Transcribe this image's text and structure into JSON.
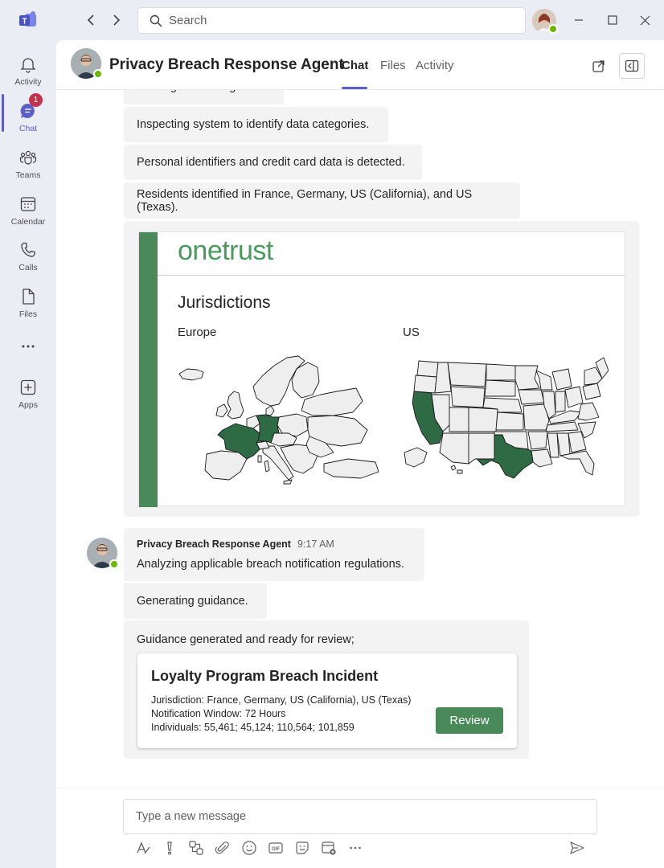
{
  "titlebar": {
    "search_placeholder": "Search"
  },
  "rail": {
    "items": [
      {
        "label": "Activity",
        "icon": "bell-icon"
      },
      {
        "label": "Chat",
        "icon": "chat-icon",
        "badge": "1"
      },
      {
        "label": "Teams",
        "icon": "teams-icon"
      },
      {
        "label": "Calendar",
        "icon": "calendar-icon"
      },
      {
        "label": "Calls",
        "icon": "phone-icon"
      },
      {
        "label": "Files",
        "icon": "file-icon"
      },
      {
        "label": "",
        "icon": "more-icon"
      },
      {
        "label": "Apps",
        "icon": "apps-icon"
      }
    ]
  },
  "header": {
    "title": "Privacy Breach Response Agent",
    "tabs": [
      "Chat",
      "Files",
      "Activity"
    ],
    "active_tab": "Chat"
  },
  "messages": {
    "m0": "Starting an investigation.",
    "m1": "Inspecting system to identify data categories.",
    "m2": "Personal identifiers and credit card data is detected.",
    "m3": "Residents identified in France, Germany, US (California), and US (Texas).",
    "sender": "Privacy Breach Response Agent",
    "time": "9:17 AM",
    "m4": "Analyzing applicable breach notification regulations.",
    "m5": "Generating guidance.",
    "m6": "Guidance generated and ready for review;"
  },
  "jurisdiction_card": {
    "brand": "onetrust",
    "heading": "Jurisdictions",
    "left_label": "Europe",
    "right_label": "US",
    "highlight_color": "#2e6b45",
    "highlighted_regions": [
      "France",
      "Germany",
      "California",
      "Texas"
    ]
  },
  "guidance_card": {
    "title": "Loyalty Program Breach Incident",
    "jurisdiction": "Jurisdiction: France, Germany, US (California), US (Texas)",
    "window": "Notification Window: 72 Hours",
    "individuals": "Individuals: 55,461; 45,124; 110,564; 101,859",
    "button": "Review"
  },
  "compose": {
    "placeholder": "Type a new message"
  },
  "colors": {
    "accent": "#5b5fc7",
    "brand_green": "#4a8a5a",
    "status_green": "#6bb700",
    "badge_red": "#c4314b"
  }
}
